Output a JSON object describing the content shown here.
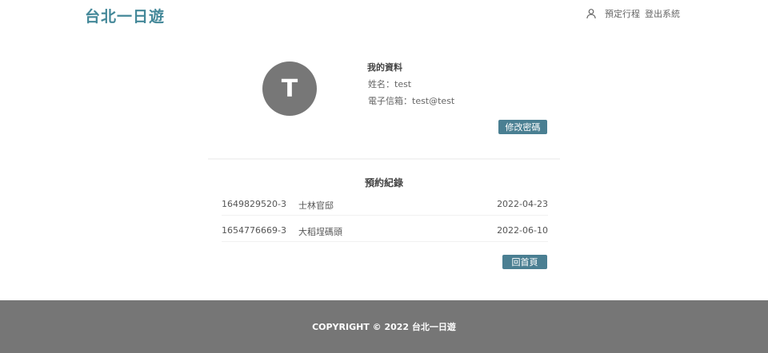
{
  "header": {
    "logo": "台北一日遊",
    "nav": {
      "icon": "user-icon",
      "booking_label": "預定行程",
      "logout_label": "登出系統"
    }
  },
  "profile": {
    "avatar_letter": "T",
    "heading": "我的資料",
    "name_line": "姓名：test",
    "email_line": "電子信箱：test@test",
    "change_password_label": "修改密碼"
  },
  "bookings": {
    "title": "預約紀錄",
    "rows": [
      {
        "id": "1649829520-3",
        "place": "士林官邸",
        "date": "2022-04-23"
      },
      {
        "id": "1654776669-3",
        "place": "大稻埕碼頭",
        "date": "2022-06-10"
      }
    ],
    "home_label": "回首頁"
  },
  "footer": {
    "copyright": "COPYRIGHT © 2022 台北一日遊"
  },
  "colors": {
    "brand": "#448899",
    "button": "#4a7f92",
    "footer_bg": "#767676",
    "avatar_bg": "#777777"
  }
}
